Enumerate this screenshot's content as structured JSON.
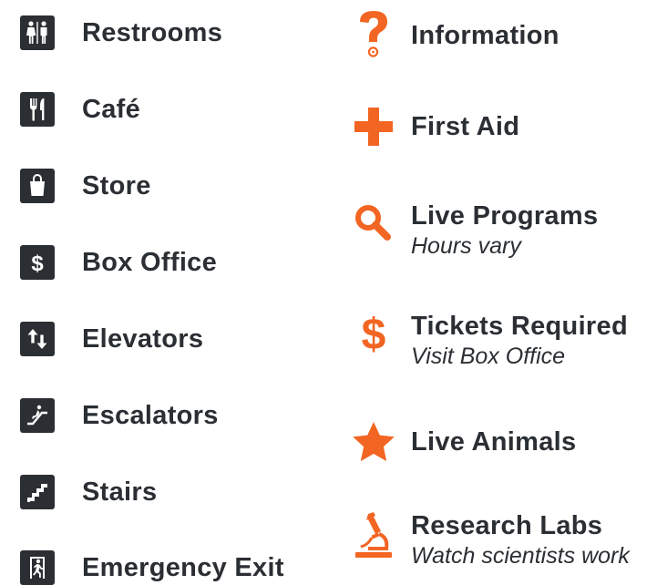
{
  "left": [
    {
      "label": "Restrooms",
      "icon": "restroom-icon"
    },
    {
      "label": "Café",
      "icon": "fork-knife-icon"
    },
    {
      "label": "Store",
      "icon": "shopping-bag-icon"
    },
    {
      "label": "Box Office",
      "icon": "dollar-icon"
    },
    {
      "label": "Elevators",
      "icon": "up-down-arrows-icon"
    },
    {
      "label": "Escalators",
      "icon": "escalator-icon"
    },
    {
      "label": "Stairs",
      "icon": "stairs-icon"
    },
    {
      "label": "Emergency Exit",
      "icon": "exit-runner-icon"
    }
  ],
  "right": [
    {
      "label": "Information",
      "sub": "",
      "icon": "question-mark-icon"
    },
    {
      "label": "First Aid",
      "sub": "",
      "icon": "cross-icon"
    },
    {
      "label": "Live Programs",
      "sub": "Hours vary",
      "icon": "magnifier-icon"
    },
    {
      "label": "Tickets Required",
      "sub": "Visit Box Office",
      "icon": "dollar-sign-icon"
    },
    {
      "label": "Live Animals",
      "sub": "",
      "icon": "star-icon"
    },
    {
      "label": "Research Labs",
      "sub": "Watch scientists work",
      "icon": "microscope-icon"
    }
  ],
  "colors": {
    "dark": "#2b2f33",
    "accent": "#f26522"
  }
}
